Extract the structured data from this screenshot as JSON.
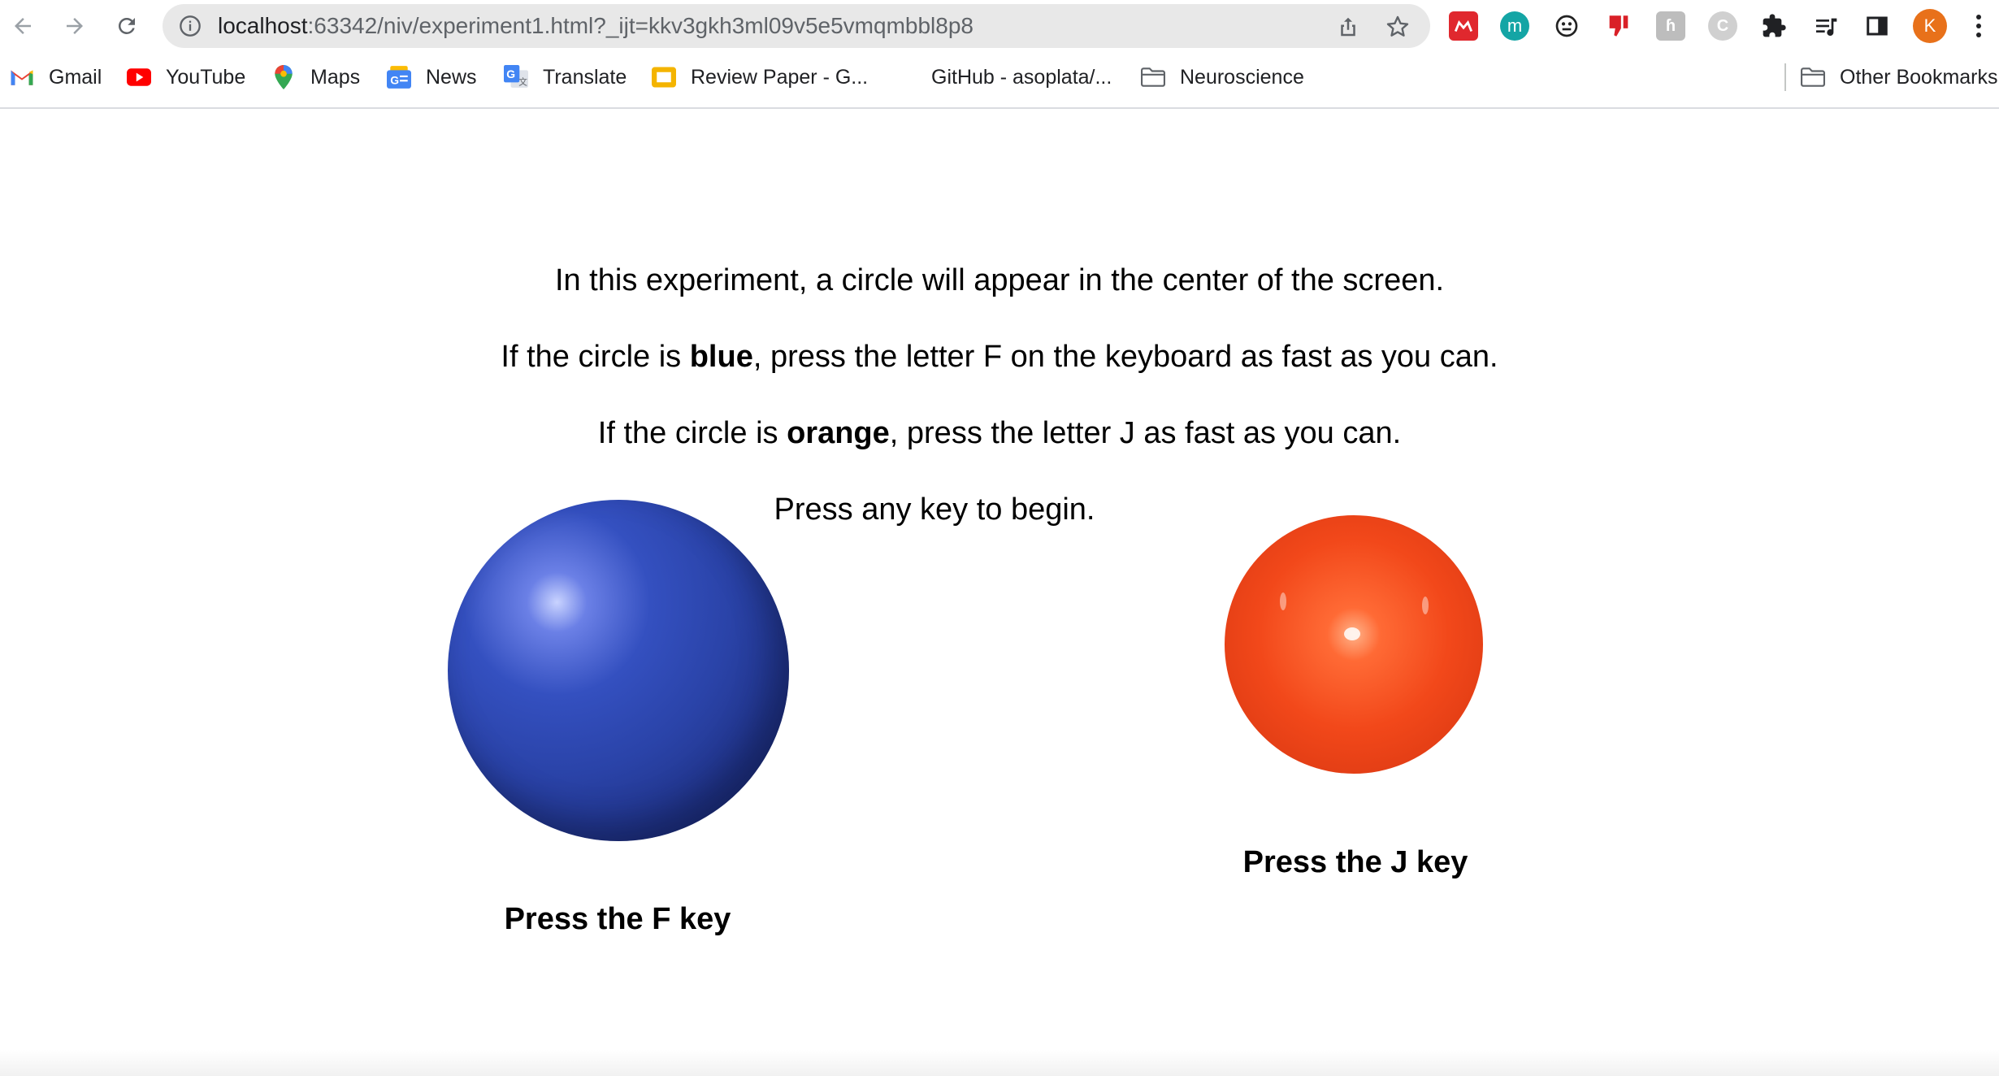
{
  "browser": {
    "url_host": "localhost",
    "url_rest": ":63342/niv/experiment1.html?_ijt=kkv3gkh3ml09v5e5vmqmbbl8p8",
    "profile_initial": "K",
    "extensions": [
      "mendeley-icon",
      "m-extension-icon",
      "puzzle-face-icon",
      "thumbs-down-icon",
      "h-extension-icon",
      "c-extension-icon",
      "extensions-puzzle-icon",
      "reading-list-icon",
      "side-panel-icon"
    ]
  },
  "bookmarks": {
    "items": [
      {
        "label": "Gmail",
        "icon": "gmail-icon"
      },
      {
        "label": "YouTube",
        "icon": "youtube-icon"
      },
      {
        "label": "Maps",
        "icon": "maps-icon"
      },
      {
        "label": "News",
        "icon": "news-icon"
      },
      {
        "label": "Translate",
        "icon": "translate-icon"
      },
      {
        "label": "Review Paper - G...",
        "icon": "slides-icon"
      },
      {
        "label": "GitHub - asoplata/...",
        "icon": "github-icon"
      },
      {
        "label": "Neuroscience",
        "icon": "folder-icon"
      }
    ],
    "other": "Other Bookmarks"
  },
  "page": {
    "line1": "In this experiment, a circle will appear in the center of the screen.",
    "line2_pre": "If the circle is ",
    "line2_bold": "blue",
    "line2_post": ", press the letter F on the keyboard as fast as you can.",
    "line3_pre": "If the circle is ",
    "line3_bold": "orange",
    "line3_post": ", press the letter J as fast as you can.",
    "line4": "Press any key to begin.",
    "caption_f": "Press the F key",
    "caption_j": "Press the J key"
  },
  "colors": {
    "blue_circle": "#2a43a8",
    "orange_circle": "#f2481a",
    "profile": "#e8711a"
  }
}
